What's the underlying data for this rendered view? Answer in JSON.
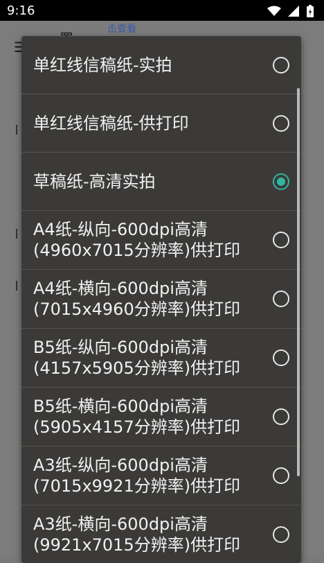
{
  "status": {
    "time": "9:16"
  },
  "background": {
    "header_text": "置",
    "link_text": "击查看",
    "menu_icon": "☰"
  },
  "dialog": {
    "options": [
      {
        "label": "单红线信稿纸-实拍",
        "selected": false
      },
      {
        "label": "单红线信稿纸-供打印",
        "selected": false
      },
      {
        "label": "草稿纸-高清实拍",
        "selected": true
      },
      {
        "label": "A4纸-纵向-600dpi高清\n(4960x7015分辨率)供打印",
        "selected": false
      },
      {
        "label": "A4纸-横向-600dpi高清\n(7015x4960分辨率)供打印",
        "selected": false
      },
      {
        "label": "B5纸-纵向-600dpi高清\n(4157x5905分辨率)供打印",
        "selected": false
      },
      {
        "label": "B5纸-横向-600dpi高清\n(5905x4157分辨率)供打印",
        "selected": false
      },
      {
        "label": "A3纸-纵向-600dpi高清\n(7015x9921分辨率)供打印",
        "selected": false
      },
      {
        "label": "A3纸-横向-600dpi高清\n(9921x7015分辨率)供打印",
        "selected": false
      }
    ]
  },
  "colors": {
    "accent": "#2fb5a3",
    "dialog_bg": "#3b3a38",
    "scrim": "#7a7a7a"
  }
}
